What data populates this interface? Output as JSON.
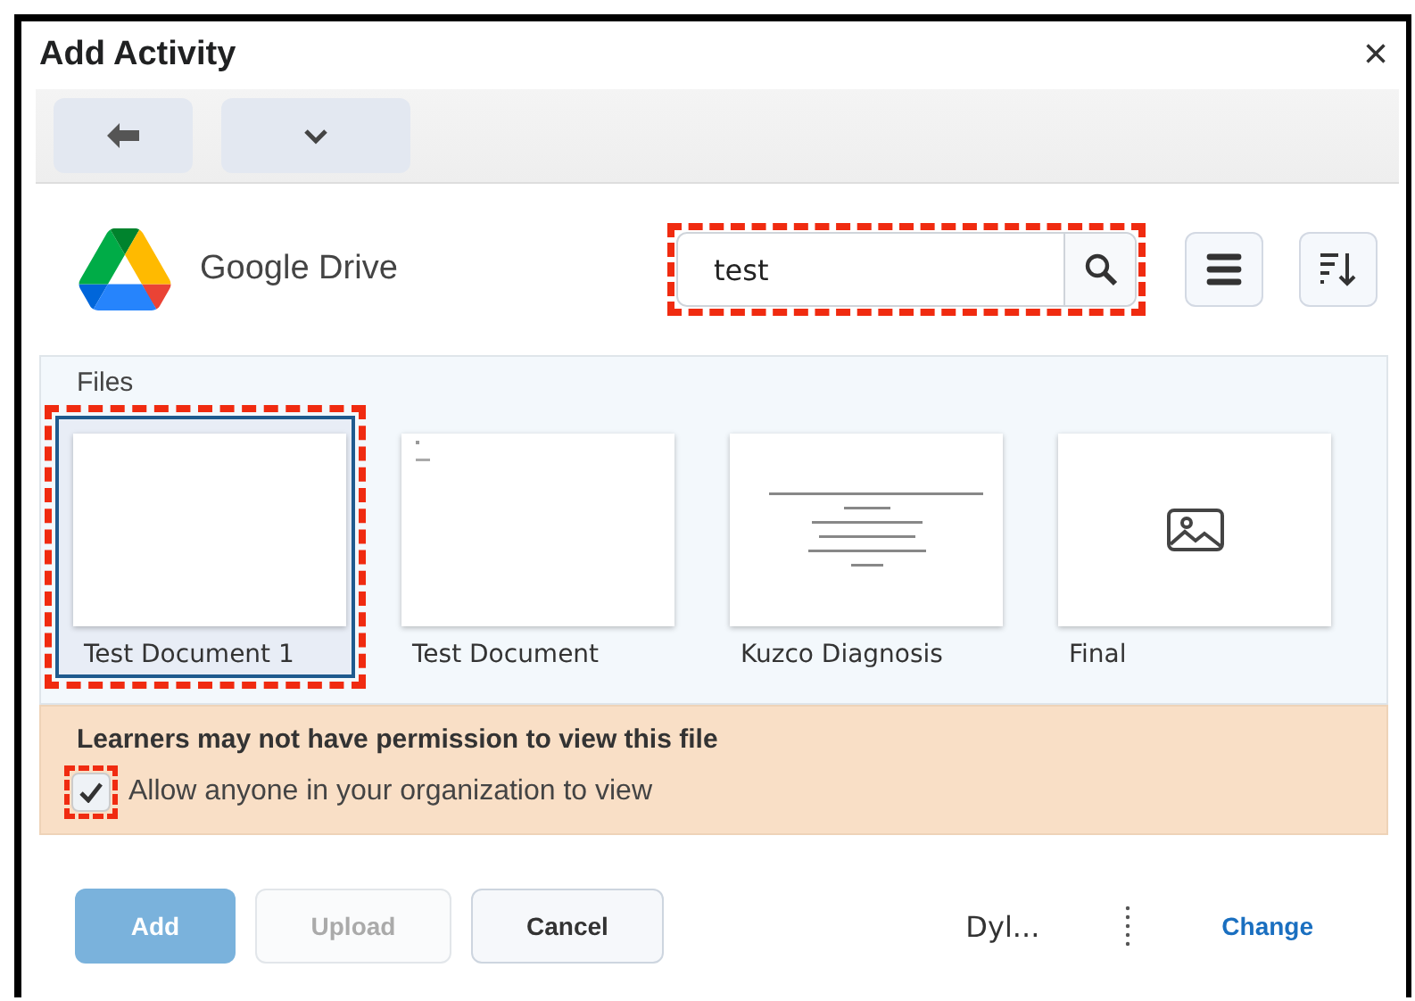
{
  "dialog": {
    "title": "Add Activity",
    "close": "×"
  },
  "provider": {
    "name": "Google Drive"
  },
  "search": {
    "value": "test",
    "highlighted": true
  },
  "files": {
    "heading": "Files",
    "items": [
      {
        "name": "Test Document 1",
        "kind": "blank",
        "selected": true,
        "highlighted": true
      },
      {
        "name": "Test Document",
        "kind": "note",
        "selected": false,
        "highlighted": false
      },
      {
        "name": "Kuzco Diagnosis",
        "kind": "title-page",
        "selected": false,
        "highlighted": false
      },
      {
        "name": "Final",
        "kind": "image",
        "selected": false,
        "highlighted": false
      }
    ]
  },
  "warning": {
    "message": "Learners may not have permission to view this file",
    "option": {
      "label": "Allow anyone in your organization to view",
      "checked": true,
      "highlighted": true
    }
  },
  "footer": {
    "buttons": [
      {
        "label": "Add",
        "kind": "primary",
        "disabled": false
      },
      {
        "label": "Upload",
        "kind": "secondary",
        "disabled": true
      },
      {
        "label": "Cancel",
        "kind": "secondary",
        "disabled": false
      }
    ],
    "account": "Dyl...",
    "change": "Change"
  }
}
